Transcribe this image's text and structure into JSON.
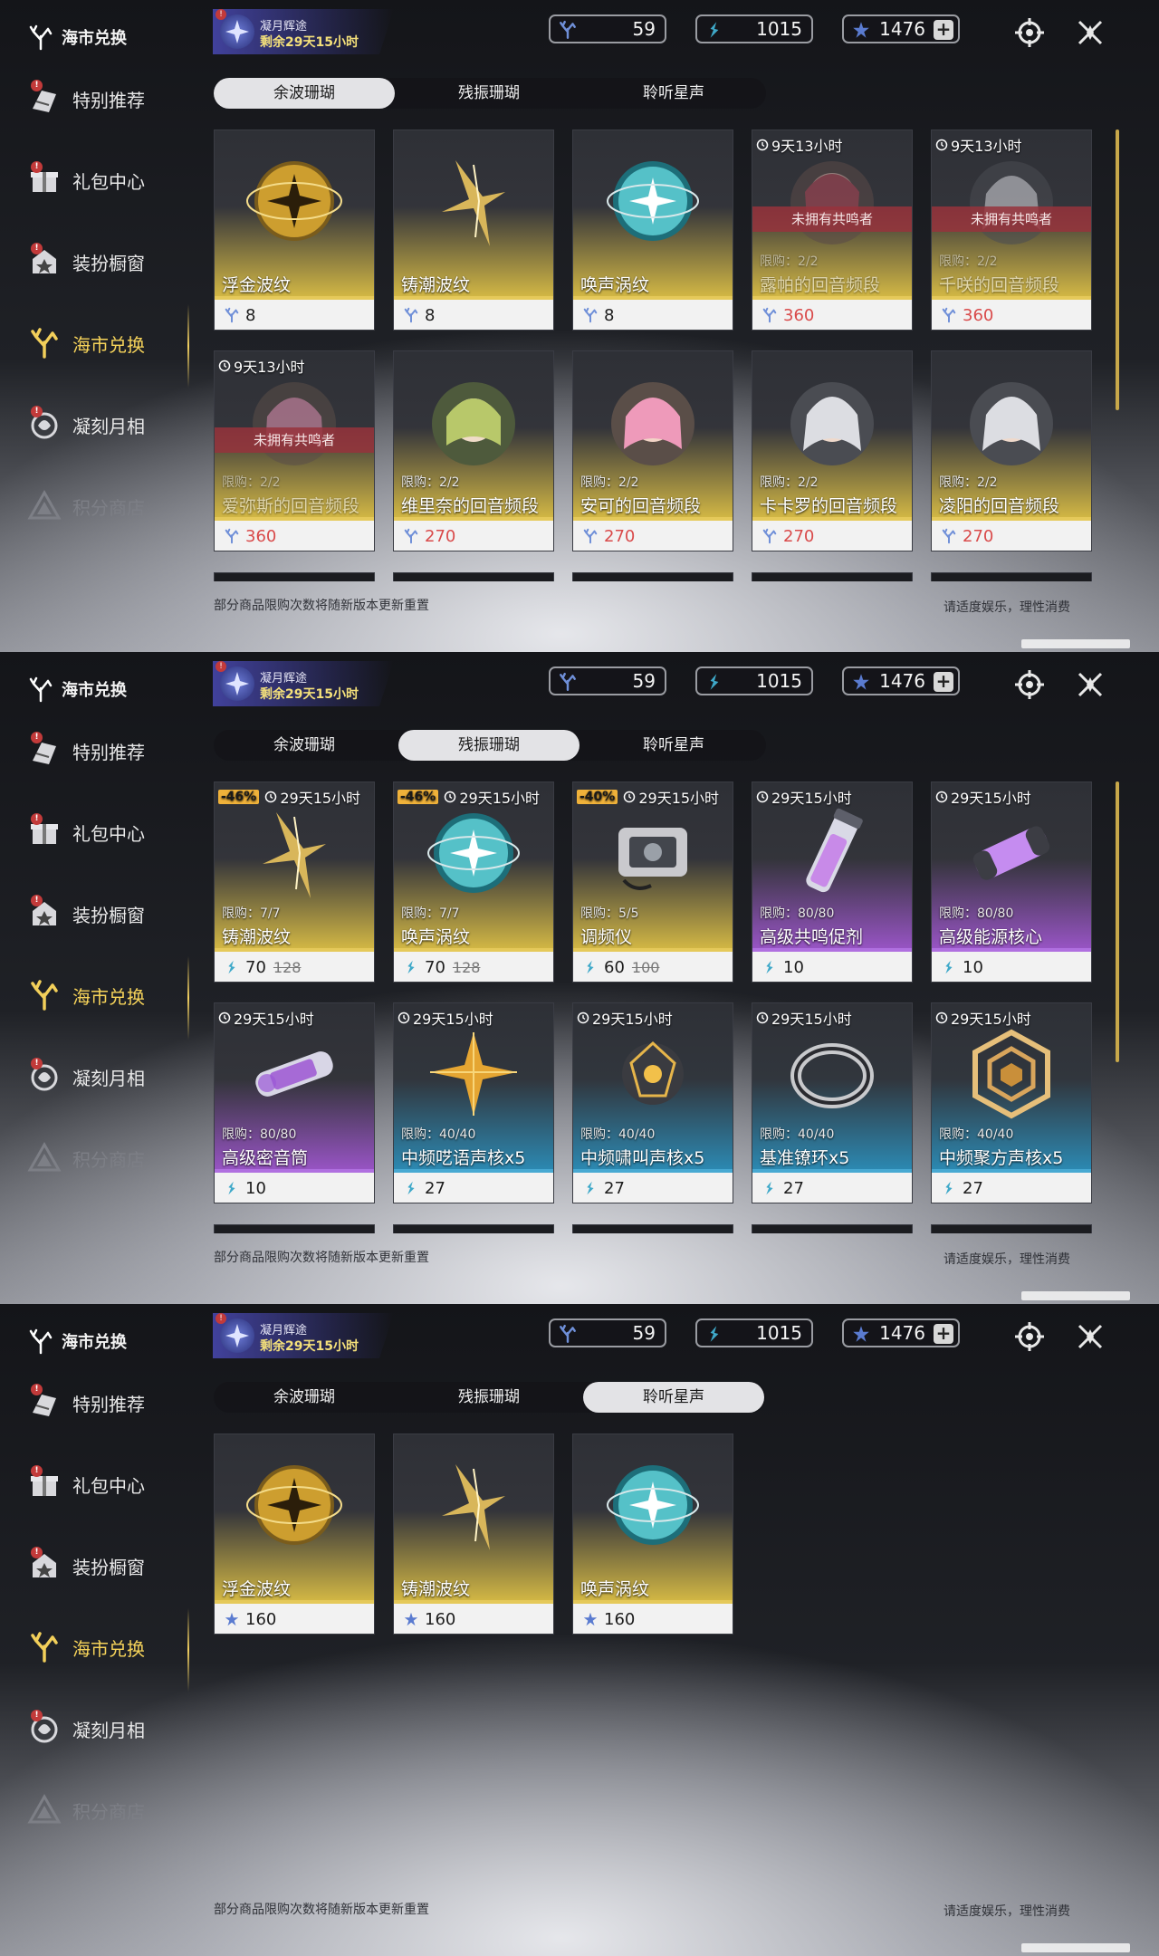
{
  "panels": [
    {
      "sidebar": {
        "logo": "海市兑换",
        "items": [
          {
            "label": "特别推荐",
            "state": "normal",
            "badge": true
          },
          {
            "label": "礼包中心",
            "state": "normal",
            "badge": true
          },
          {
            "label": "装扮橱窗",
            "state": "normal",
            "badge": true
          },
          {
            "label": "海市兑换",
            "state": "active",
            "badge": false
          },
          {
            "label": "凝刻月相",
            "state": "normal",
            "badge": true
          },
          {
            "label": "积分商店",
            "state": "dim",
            "badge": false
          }
        ]
      },
      "event": {
        "title": "凝月辉途",
        "remaining": "剩余29天15小时"
      },
      "currencies": [
        "59",
        "1015",
        "1476"
      ],
      "tabs": [
        "余波珊瑚",
        "残振珊瑚",
        "聆听星声"
      ],
      "selected_tab": 0,
      "cards": [
        {
          "name": "浮金波纹",
          "price": "8",
          "icon": "gold-orb",
          "tier": "gold",
          "currency": "coral"
        },
        {
          "name": "铸潮波纹",
          "price": "8",
          "icon": "gold-blade",
          "tier": "gold",
          "currency": "coral"
        },
        {
          "name": "唤声涡纹",
          "price": "8",
          "icon": "cyan-orb",
          "tier": "gold",
          "currency": "coral"
        },
        {
          "name": "露帕的回音频段",
          "price": "360",
          "icon": "portrait-red",
          "tier": "gold",
          "currency": "coral",
          "timer": "9天13小时",
          "limit": "限购：2/2",
          "banner": "未拥有共鸣者",
          "faded": true,
          "red_price": true
        },
        {
          "name": "千咲的回音频段",
          "price": "360",
          "icon": "portrait-white",
          "tier": "gold",
          "currency": "coral",
          "timer": "9天13小时",
          "limit": "限购：2/2",
          "banner": "未拥有共鸣者",
          "faded": true,
          "red_price": true
        },
        {
          "name": "爱弥斯的回音频段",
          "price": "360",
          "icon": "portrait-pink",
          "tier": "gold",
          "currency": "coral",
          "timer": "9天13小时",
          "limit": "限购：2/2",
          "banner": "未拥有共鸣者",
          "faded": true,
          "red_price": true
        },
        {
          "name": "维里奈的回音频段",
          "price": "270",
          "icon": "portrait-green",
          "tier": "gold",
          "currency": "coral",
          "limit": "限购：2/2",
          "red_price": true
        },
        {
          "name": "安可的回音频段",
          "price": "270",
          "icon": "portrait-pink",
          "tier": "gold",
          "currency": "coral",
          "limit": "限购：2/2",
          "red_price": true
        },
        {
          "name": "卡卡罗的回音频段",
          "price": "270",
          "icon": "portrait-white",
          "tier": "gold",
          "currency": "coral",
          "limit": "限购：2/2",
          "red_price": true
        },
        {
          "name": "凌阳的回音频段",
          "price": "270",
          "icon": "portrait-white",
          "tier": "gold",
          "currency": "coral",
          "limit": "限购：2/2",
          "red_price": true
        }
      ],
      "peek_row": true,
      "footer_left": "部分商品限购次数将随新版本更新重置",
      "footer_right": "请适度娱乐，理性消费"
    },
    {
      "sidebar": {
        "logo": "海市兑换",
        "items": [
          {
            "label": "特别推荐",
            "state": "normal",
            "badge": true
          },
          {
            "label": "礼包中心",
            "state": "normal",
            "badge": true
          },
          {
            "label": "装扮橱窗",
            "state": "normal",
            "badge": true
          },
          {
            "label": "海市兑换",
            "state": "active",
            "badge": false
          },
          {
            "label": "凝刻月相",
            "state": "normal",
            "badge": true
          },
          {
            "label": "积分商店",
            "state": "dim",
            "badge": false
          }
        ]
      },
      "event": {
        "title": "凝月辉途",
        "remaining": "剩余29天15小时"
      },
      "currencies": [
        "59",
        "1015",
        "1476"
      ],
      "tabs": [
        "余波珊瑚",
        "残振珊瑚",
        "聆听星声"
      ],
      "selected_tab": 1,
      "cards": [
        {
          "name": "铸潮波纹",
          "price": "70",
          "old_price": "128",
          "discount": "-46%",
          "timer": "29天15小时",
          "limit": "限购：7/7",
          "icon": "gold-blade",
          "tier": "gold",
          "currency": "shard"
        },
        {
          "name": "唤声涡纹",
          "price": "70",
          "old_price": "128",
          "discount": "-46%",
          "timer": "29天15小时",
          "limit": "限购：7/7",
          "icon": "cyan-orb",
          "tier": "gold",
          "currency": "shard"
        },
        {
          "name": "调频仪",
          "price": "60",
          "old_price": "100",
          "discount": "-40%",
          "timer": "29天15小时",
          "limit": "限购：5/5",
          "icon": "device",
          "tier": "gold",
          "currency": "shard"
        },
        {
          "name": "高级共鸣促剂",
          "price": "10",
          "timer": "29天15小时",
          "limit": "限购：80/80",
          "icon": "vial",
          "tier": "purple",
          "currency": "shard"
        },
        {
          "name": "高级能源核心",
          "price": "10",
          "timer": "29天15小时",
          "limit": "限购：80/80",
          "icon": "capsule",
          "tier": "purple",
          "currency": "shard"
        },
        {
          "name": "高级密音筒",
          "price": "10",
          "timer": "29天15小时",
          "limit": "限购：80/80",
          "icon": "cylinder",
          "tier": "purple",
          "currency": "shard"
        },
        {
          "name": "中频呓语声核x5",
          "price": "27",
          "timer": "29天15小时",
          "limit": "限购：40/40",
          "icon": "star-core",
          "tier": "blue",
          "currency": "shard"
        },
        {
          "name": "中频啸叫声核x5",
          "price": "27",
          "timer": "29天15小时",
          "limit": "限购：40/40",
          "icon": "dark-core",
          "tier": "blue",
          "currency": "shard"
        },
        {
          "name": "基准镣环x5",
          "price": "27",
          "timer": "29天15小时",
          "limit": "限购：40/40",
          "icon": "ring",
          "tier": "blue",
          "currency": "shard"
        },
        {
          "name": "中频聚方声核x5",
          "price": "27",
          "timer": "29天15小时",
          "limit": "限购：40/40",
          "icon": "hex-core",
          "tier": "blue",
          "currency": "shard"
        }
      ],
      "peek_row": true,
      "footer_left": "部分商品限购次数将随新版本更新重置",
      "footer_right": "请适度娱乐，理性消费"
    },
    {
      "sidebar": {
        "logo": "海市兑换",
        "items": [
          {
            "label": "特别推荐",
            "state": "normal",
            "badge": true
          },
          {
            "label": "礼包中心",
            "state": "normal",
            "badge": true
          },
          {
            "label": "装扮橱窗",
            "state": "normal",
            "badge": true
          },
          {
            "label": "海市兑换",
            "state": "active",
            "badge": false
          },
          {
            "label": "凝刻月相",
            "state": "normal",
            "badge": true
          },
          {
            "label": "积分商店",
            "state": "dim",
            "badge": false
          }
        ]
      },
      "event": {
        "title": "凝月辉途",
        "remaining": "剩余29天15小时"
      },
      "currencies": [
        "59",
        "1015",
        "1476"
      ],
      "tabs": [
        "余波珊瑚",
        "残振珊瑚",
        "聆听星声"
      ],
      "selected_tab": 2,
      "cards": [
        {
          "name": "浮金波纹",
          "price": "160",
          "icon": "gold-orb",
          "tier": "gold",
          "currency": "star"
        },
        {
          "name": "铸潮波纹",
          "price": "160",
          "icon": "gold-blade",
          "tier": "gold",
          "currency": "star"
        },
        {
          "name": "唤声涡纹",
          "price": "160",
          "icon": "cyan-orb",
          "tier": "gold",
          "currency": "star"
        }
      ],
      "peek_row": false,
      "footer_left": "部分商品限购次数将随新版本更新重置",
      "footer_right": "请适度娱乐，理性消费"
    }
  ]
}
